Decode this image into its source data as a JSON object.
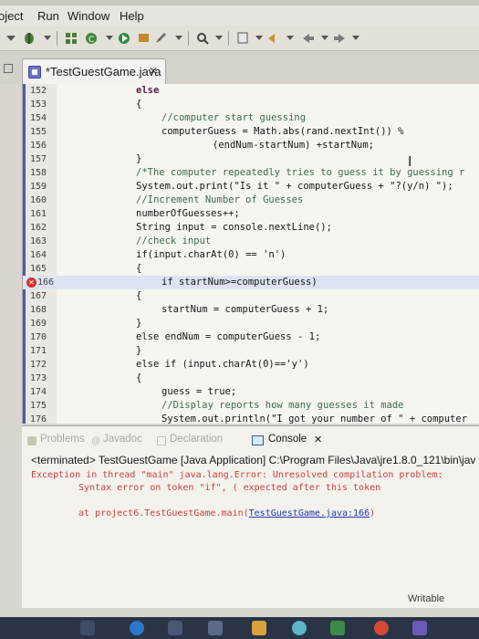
{
  "menubar": {
    "items": [
      {
        "label": "oject"
      },
      {
        "label": "Run"
      },
      {
        "label": "Window"
      },
      {
        "label": "Help"
      }
    ]
  },
  "editor_tab": {
    "label": "*TestGuestGame.java",
    "close": "✕"
  },
  "code_lines": [
    {
      "num": "152",
      "text": "else"
    },
    {
      "num": "153",
      "text": "{"
    },
    {
      "num": "154",
      "text": "//computer start guessing"
    },
    {
      "num": "155",
      "text": "computerGuess = Math.abs(rand.nextInt()) %"
    },
    {
      "num": "156",
      "text": "(endNum-startNum) +startNum;"
    },
    {
      "num": "157",
      "text": "}"
    },
    {
      "num": "158",
      "text": "/*The computer repeatedly tries to guess it by guessing r"
    },
    {
      "num": "159",
      "text": "System.out.print(\"Is it \" + computerGuess + \"?(y/n) \");"
    },
    {
      "num": "160",
      "text": "//Increment Number of Guesses"
    },
    {
      "num": "161",
      "text": "numberOfGuesses++;"
    },
    {
      "num": "162",
      "text": "String input = console.nextLine();"
    },
    {
      "num": "163",
      "text": "//check input"
    },
    {
      "num": "164",
      "text": "if(input.charAt(0) == 'n')"
    },
    {
      "num": "165",
      "text": "{"
    },
    {
      "num": "166",
      "text": "if startNum>=computerGuess)"
    },
    {
      "num": "167",
      "text": "{"
    },
    {
      "num": "168",
      "text": "startNum = computerGuess + 1;"
    },
    {
      "num": "169",
      "text": "}"
    },
    {
      "num": "170",
      "text": "else endNum = computerGuess - 1;"
    },
    {
      "num": "171",
      "text": "}"
    },
    {
      "num": "172",
      "text": "else if (input.charAt(0)=='y')"
    },
    {
      "num": "173",
      "text": "{"
    },
    {
      "num": "174",
      "text": "guess = true;"
    },
    {
      "num": "175",
      "text": "//Display reports how many guesses it made"
    },
    {
      "num": "176",
      "text": "System.out.println(\"I got your number of \" + computer"
    }
  ],
  "panel": {
    "tabs": [
      {
        "label": "Problems"
      },
      {
        "label": "Javadoc"
      },
      {
        "label": "Declaration"
      },
      {
        "label": "Console"
      }
    ],
    "console_close": "✕",
    "terminated": "<terminated> TestGuestGame [Java Application] C:\\Program Files\\Java\\jre1.8.0_121\\bin\\jav",
    "exception": "Exception in thread \"main\" java.lang.Error: Unresolved compilation problem:",
    "syntax_error": "Syntax error on token \"if\", ( expected after this token",
    "trace_prefix": "at project6.TestGuestGame.main(",
    "trace_link": "TestGuestGame.java:166",
    "trace_suffix": ")"
  },
  "status": {
    "text": "Writable"
  },
  "colors": {
    "keyword": "#5b1a4a",
    "string": "#1f2ab0",
    "comment": "#3c6b4d",
    "error": "#cf3f3f"
  },
  "icons": [
    "run-icon",
    "debug-icon",
    "search-icon",
    "back-icon",
    "forward-icon",
    "java-file-icon",
    "error-marker-icon",
    "console-icon"
  ]
}
